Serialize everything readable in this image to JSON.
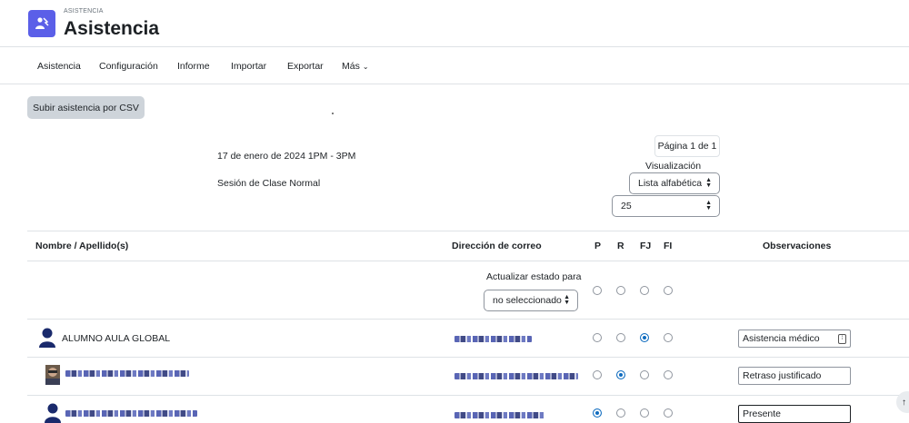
{
  "header": {
    "overline": "ASISTENCIA",
    "title": "Asistencia",
    "icon": "attendance-icon",
    "icon_color": "#5b5fe8"
  },
  "nav": {
    "items": [
      "Asistencia",
      "Configuración",
      "Informe",
      "Importar",
      "Exportar",
      "Más"
    ]
  },
  "toolbar": {
    "csv_button": "Subir asistencia por CSV"
  },
  "session": {
    "date": "17 de enero de 2024 1PM - 3PM",
    "type": "Sesión de Clase Normal"
  },
  "controls": {
    "pager": "Página 1 de 1",
    "view_label": "Visualización",
    "order_value": "Lista alfabética",
    "per_page_value": "25"
  },
  "table": {
    "headers": {
      "name": "Nombre / Apellido(s)",
      "email": "Dirección de correo",
      "p": "P",
      "r": "R",
      "fj": "FJ",
      "fi": "FI",
      "obs": "Observaciones"
    },
    "update_label": "Actualizar estado para",
    "update_value": "no seleccionado",
    "rows": [
      {
        "name": "ALUMNO AULA GLOBAL",
        "status": "FJ",
        "remark": "Asistencia médico"
      },
      {
        "name": "",
        "status": "R",
        "remark": "Retraso justificado"
      },
      {
        "name": "",
        "status": "P",
        "remark": "Presente"
      }
    ]
  },
  "colors": {
    "accent": "#0f6cbf",
    "button_bg": "#ced4da",
    "border": "#dee2e6"
  }
}
